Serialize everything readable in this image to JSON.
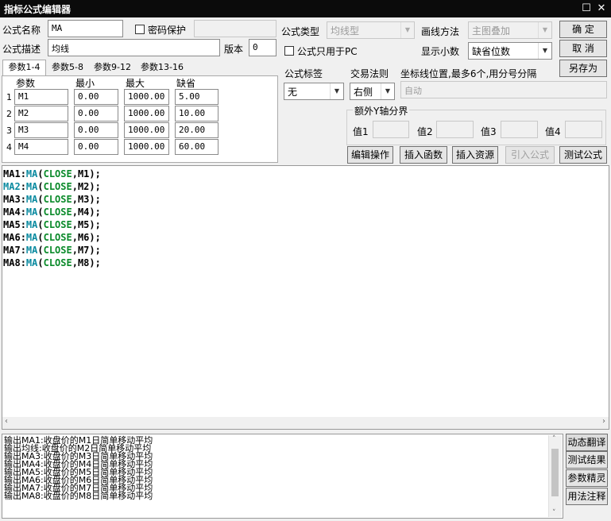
{
  "window": {
    "title": "指标公式编辑器",
    "restore_glyph": "☐",
    "close_glyph": "✕"
  },
  "form": {
    "name_label": "公式名称",
    "name_value": "MA",
    "password_label": "密码保护",
    "password_value": "",
    "desc_label": "公式描述",
    "desc_value": "均线",
    "version_label": "版本",
    "version_value": "0",
    "type_label": "公式类型",
    "type_value": "均线型",
    "draw_label": "画线方法",
    "draw_value": "主图叠加",
    "pc_only_label": "公式只用于PC",
    "decimals_label": "显示小数",
    "decimals_value": "缺省位数",
    "tag_label": "公式标签",
    "tag_value": "无",
    "trade_label": "交易法则",
    "trade_value": "右侧",
    "axis_label": "坐标线位置,最多6个,用分号分隔",
    "axis_value": "自动"
  },
  "buttons": {
    "ok": "确  定",
    "cancel": "取  消",
    "save_as": "另存为"
  },
  "tabs": [
    "参数1-4",
    "参数5-8",
    "参数9-12",
    "参数13-16"
  ],
  "params": {
    "headers": [
      "参数",
      "最小",
      "最大",
      "缺省"
    ],
    "rows": [
      {
        "idx": "1",
        "name": "M1",
        "min": "0.00",
        "max": "1000.00",
        "def": "5.00"
      },
      {
        "idx": "2",
        "name": "M2",
        "min": "0.00",
        "max": "1000.00",
        "def": "10.00"
      },
      {
        "idx": "3",
        "name": "M3",
        "min": "0.00",
        "max": "1000.00",
        "def": "20.00"
      },
      {
        "idx": "4",
        "name": "M4",
        "min": "0.00",
        "max": "1000.00",
        "def": "60.00"
      }
    ]
  },
  "y_axis": {
    "title": "额外Y轴分界",
    "labels": [
      "值1",
      "值2",
      "值3",
      "值4"
    ],
    "values": [
      "",
      "",
      "",
      ""
    ]
  },
  "toolbar": [
    "编辑操作",
    "插入函数",
    "插入资源",
    "引入公式",
    "测试公式"
  ],
  "code": [
    {
      "a": "MA1",
      "b": ":",
      "f": "MA",
      "p": "(",
      "k": "CLOSE",
      "r": ",M1);"
    },
    {
      "a": "MA2",
      "b": ":",
      "f": "MA",
      "p": "(",
      "k": "CLOSE",
      "r": ",M2);"
    },
    {
      "a": "MA3",
      "b": ":",
      "f": "MA",
      "p": "(",
      "k": "CLOSE",
      "r": ",M3);"
    },
    {
      "a": "MA4",
      "b": ":",
      "f": "MA",
      "p": "(",
      "k": "CLOSE",
      "r": ",M4);"
    },
    {
      "a": "MA5",
      "b": ":",
      "f": "MA",
      "p": "(",
      "k": "CLOSE",
      "r": ",M5);"
    },
    {
      "a": "MA6",
      "b": ":",
      "f": "MA",
      "p": "(",
      "k": "CLOSE",
      "r": ",M6);"
    },
    {
      "a": "MA7",
      "b": ":",
      "f": "MA",
      "p": "(",
      "k": "CLOSE",
      "r": ",M7);"
    },
    {
      "a": "MA8",
      "b": ":",
      "f": "MA",
      "p": "(",
      "k": "CLOSE",
      "r": ",M8);"
    }
  ],
  "output_lines": [
    "输出MA1:收盘价的M1日简单移动平均",
    "输出均线:收盘价的M2日简单移动平均",
    "输出MA3:收盘价的M3日简单移动平均",
    "输出MA4:收盘价的M4日简单移动平均",
    "输出MA5:收盘价的M5日简单移动平均",
    "输出MA6:收盘价的M6日简单移动平均",
    "输出MA7:收盘价的M7日简单移动平均",
    "输出MA8:收盘价的M8日简单移动平均"
  ],
  "side_buttons": [
    "动态翻译",
    "测试结果",
    "参数精灵",
    "用法注释"
  ],
  "colors": {
    "title_bg": "#0b0b0b",
    "code_teal": "#0a8aa0",
    "code_green": "#0a8a2a"
  }
}
